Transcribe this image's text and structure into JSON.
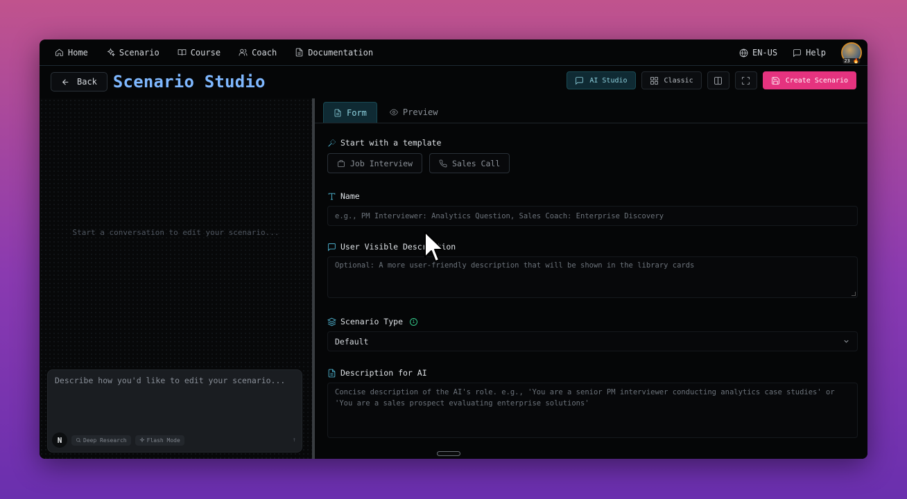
{
  "nav": {
    "items": [
      {
        "label": "Home",
        "icon": "home-icon"
      },
      {
        "label": "Scenario",
        "icon": "sparkles-icon"
      },
      {
        "label": "Course",
        "icon": "book-icon"
      },
      {
        "label": "Coach",
        "icon": "users-icon"
      },
      {
        "label": "Documentation",
        "icon": "file-icon"
      }
    ],
    "language": "EN-US",
    "help": "Help",
    "avatar_badge": "23 🔥"
  },
  "header": {
    "back_label": "Back",
    "title": "Scenario Studio",
    "ai_studio_label": "AI Studio",
    "classic_label": "Classic",
    "create_label": "Create Scenario"
  },
  "left": {
    "empty_message": "Start a conversation to edit your scenario...",
    "chat_placeholder": "Describe how you'd like to edit your scenario...",
    "n_button": "N",
    "deep_research": "Deep Research",
    "flash_mode": "Flash Mode",
    "send_glyph": "↑"
  },
  "tabs": {
    "form": "Form",
    "preview": "Preview"
  },
  "form": {
    "template_label": "Start with a template",
    "templates": [
      "Job Interview",
      "Sales Call"
    ],
    "name_label": "Name",
    "name_placeholder": "e.g., PM Interviewer: Analytics Question, Sales Coach: Enterprise Discovery",
    "uvd_label": "User Visible Description",
    "uvd_placeholder": "Optional: A more user-friendly description that will be shown in the library cards",
    "type_label": "Scenario Type",
    "type_value": "Default",
    "ai_desc_label": "Description for AI",
    "ai_desc_placeholder": "Concise description of the AI's role. e.g., 'You are a senior PM interviewer conducting analytics case studies' or 'You are a sales prospect evaluating enterprise solutions'"
  },
  "colors": {
    "title": "#7fb8ff",
    "accent": "#4fb6d3",
    "primary": "#e5337f",
    "info": "#34c98a"
  }
}
